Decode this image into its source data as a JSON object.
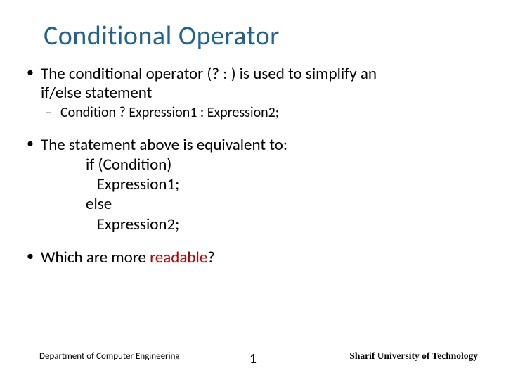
{
  "title": "Conditional Operator",
  "bullets": {
    "b1_line1": "The conditional operator (? : ) is used to simplify an",
    "b1_line2": "if/else statement",
    "b1_sub": "Condition ? Expression1 : Expression2;",
    "b2_intro": "The statement above is equivalent to:",
    "b2_code": "if (Condition)\n   Expression1;\nelse\n   Expression2;",
    "b3_prefix": "Which are more ",
    "b3_readable": "readable",
    "b3_suffix": "?"
  },
  "footer": {
    "left": "Department of Computer Engineering",
    "page": "1",
    "right": "Sharif University of Technology"
  }
}
